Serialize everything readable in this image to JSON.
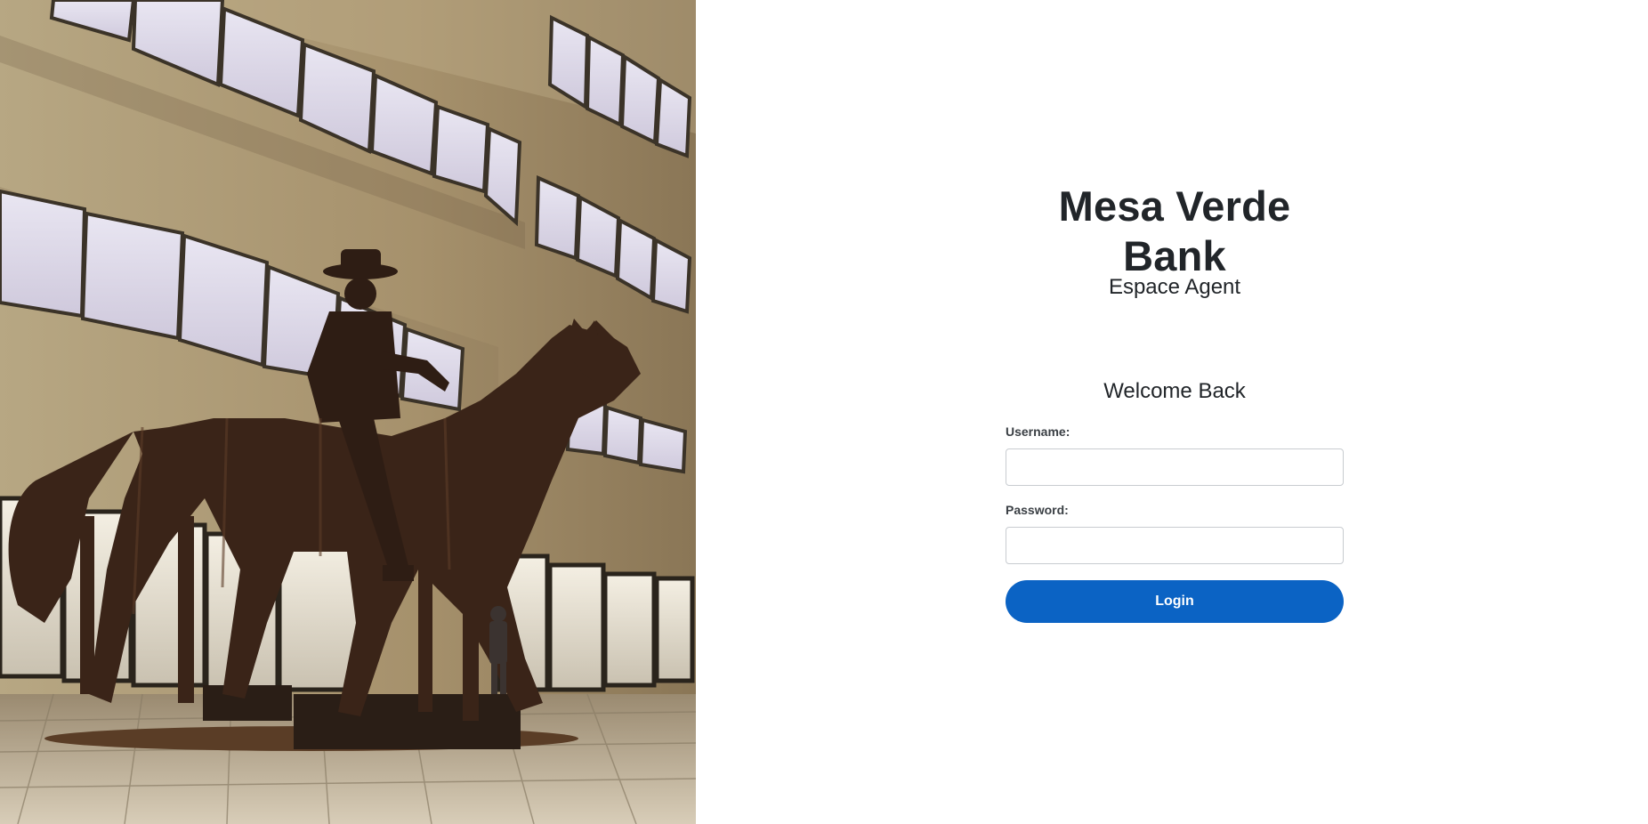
{
  "brand": {
    "title": "Mesa Verde Bank",
    "subtitle": "Espace Agent"
  },
  "login_form": {
    "heading": "Welcome Back",
    "username_label": "Username:",
    "username_value": "",
    "password_label": "Password:",
    "password_value": "",
    "submit_label": "Login"
  },
  "colors": {
    "primary_button": "#0b63c4",
    "text": "#212529",
    "background": "#ffffff"
  },
  "hero_image": {
    "subject": "cowboy-on-horse-silhouette-atrium-photo"
  }
}
